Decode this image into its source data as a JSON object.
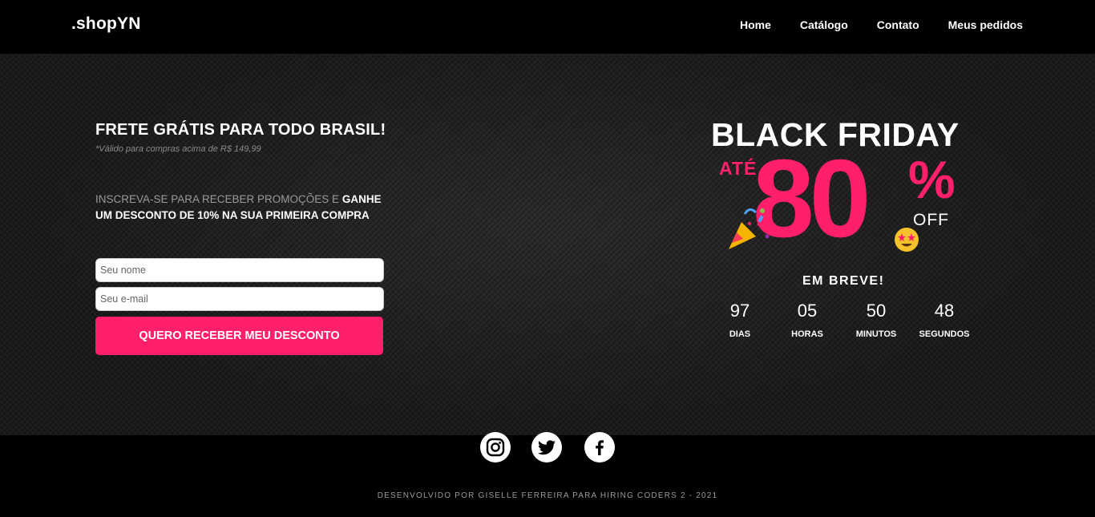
{
  "logo": {
    "part1": ".shop",
    "part2": "YN"
  },
  "nav": {
    "home": "Home",
    "catalog": "Catálogo",
    "contact": "Contato",
    "orders": "Meus pedidos"
  },
  "hero": {
    "frete_title": "FRETE GRÁTIS PARA TODO BRASIL!",
    "frete_note": "*Válido para compras acima de R$ 149,99",
    "promo_gray": "INSCREVA-SE PARA RECEBER PROMOÇÕES E",
    "promo_white": "GANHE UM DESCONTO DE 10% NA SUA PRIMEIRA COMPRA",
    "name_placeholder": "Seu nome",
    "email_placeholder": "Seu e-mail",
    "cta": "QUERO RECEBER MEU DESCONTO"
  },
  "blackfriday": {
    "title": "BLACK FRIDAY",
    "ate": "ATÉ",
    "number": "80",
    "percent": "%",
    "off": "OFF",
    "breve": "EM BREVE!",
    "countdown": [
      {
        "value": "97",
        "label": "DIAS"
      },
      {
        "value": "05",
        "label": "HORAS"
      },
      {
        "value": "50",
        "label": "MINUTOS"
      },
      {
        "value": "48",
        "label": "SEGUNDOS"
      }
    ]
  },
  "footer": {
    "social": [
      "instagram-icon",
      "twitter-icon",
      "facebook-icon"
    ],
    "credit": "DESENVOLVIDO POR GISELLE FERREIRA PARA HIRING CODERS 2 - 2021"
  },
  "colors": {
    "accent": "#ff1f6a",
    "background": "#000000"
  }
}
